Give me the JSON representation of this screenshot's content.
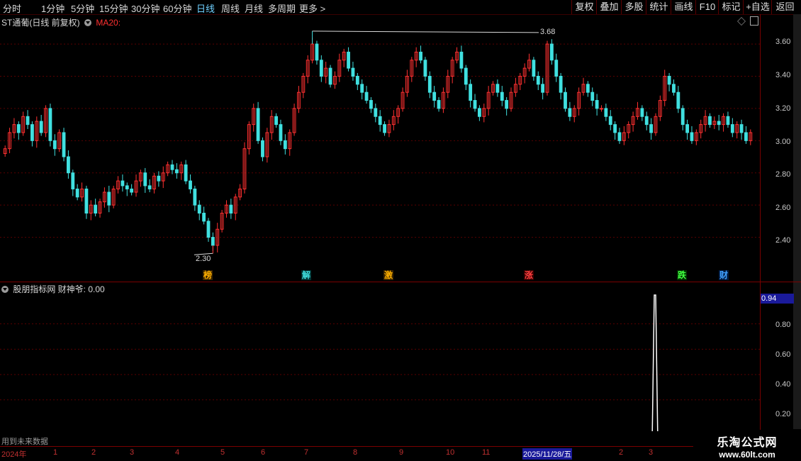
{
  "toolbar": {
    "periods": [
      "分时",
      "1分钟",
      "5分钟",
      "15分钟",
      "30分钟",
      "60分钟",
      "日线",
      "周线",
      "月线",
      "多周期",
      "更多 >"
    ],
    "active_period": "日线",
    "buttons": [
      "复权",
      "叠加",
      "多股",
      "统计",
      "画线",
      "F10",
      "标记",
      "+自选",
      "返回"
    ]
  },
  "main_panel": {
    "title": "ST通葡(日线 前复权)",
    "indicator": "MA20:",
    "indicator_color": "#ff3030",
    "y_labels": [
      "3.60",
      "3.40",
      "3.20",
      "3.00",
      "2.80",
      "2.60",
      "2.40"
    ],
    "high_label": "3.68",
    "low_label": "2.30",
    "tags": [
      {
        "text": "榜",
        "color": "#ffb000",
        "bg": "#3a2400"
      },
      {
        "text": "解",
        "color": "#40e0e0",
        "bg": "#003030"
      },
      {
        "text": "激",
        "color": "#ffb000",
        "bg": "#3a2400"
      },
      {
        "text": "涨",
        "color": "#ff4040",
        "bg": "#3a0000"
      },
      {
        "text": "跌",
        "color": "#40ff40",
        "bg": "#003000"
      },
      {
        "text": "财",
        "color": "#40a0ff",
        "bg": "#001a40"
      }
    ],
    "up_color": "#ff3030",
    "down_color": "#40e0e0"
  },
  "indicator_panel": {
    "title": "股朋指标网 财神爷: 0.00",
    "current_value": "0.94",
    "y_labels": [
      "0.80",
      "0.60",
      "0.40",
      "0.20"
    ],
    "footer_note": "用到未来数据"
  },
  "date_axis": {
    "labels": [
      "2024年",
      "1",
      "2",
      "3",
      "4",
      "5",
      "6",
      "7",
      "8",
      "9",
      "10",
      "11",
      "2025/11/28/五",
      "2",
      "3"
    ]
  },
  "watermark": {
    "title": "乐淘公式网",
    "url": "www.60lt.com"
  },
  "chart_data": {
    "type": "candlestick",
    "ylim": [
      2.2,
      3.75
    ],
    "y_ticks": [
      2.4,
      2.6,
      2.8,
      3.0,
      3.2,
      3.4,
      3.6
    ],
    "close_series": [
      2.95,
      3.05,
      3.1,
      3.05,
      3.15,
      3.1,
      3.0,
      3.12,
      3.05,
      3.2,
      3.0,
      2.95,
      3.05,
      2.9,
      2.8,
      2.7,
      2.65,
      2.7,
      2.55,
      2.6,
      2.55,
      2.62,
      2.68,
      2.6,
      2.7,
      2.75,
      2.72,
      2.7,
      2.68,
      2.75,
      2.8,
      2.72,
      2.7,
      2.78,
      2.75,
      2.8,
      2.85,
      2.82,
      2.8,
      2.85,
      2.75,
      2.7,
      2.6,
      2.55,
      2.5,
      2.4,
      2.35,
      2.45,
      2.55,
      2.6,
      2.55,
      2.65,
      2.7,
      2.95,
      3.1,
      3.2,
      3.0,
      2.9,
      3.05,
      3.15,
      3.1,
      3.0,
      2.95,
      3.05,
      3.2,
      3.3,
      3.4,
      3.5,
      3.6,
      3.5,
      3.4,
      3.45,
      3.35,
      3.4,
      3.5,
      3.55,
      3.45,
      3.4,
      3.35,
      3.3,
      3.25,
      3.2,
      3.15,
      3.1,
      3.05,
      3.1,
      3.15,
      3.2,
      3.3,
      3.4,
      3.5,
      3.55,
      3.5,
      3.4,
      3.3,
      3.25,
      3.2,
      3.3,
      3.4,
      3.5,
      3.55,
      3.45,
      3.35,
      3.25,
      3.2,
      3.15,
      3.2,
      3.3,
      3.35,
      3.3,
      3.25,
      3.2,
      3.3,
      3.35,
      3.4,
      3.45,
      3.5,
      3.4,
      3.35,
      3.3,
      3.6,
      3.5,
      3.4,
      3.3,
      3.2,
      3.15,
      3.2,
      3.3,
      3.35,
      3.3,
      3.25,
      3.2,
      3.2,
      3.15,
      3.1,
      3.05,
      3.0,
      3.05,
      3.1,
      3.15,
      3.2,
      3.15,
      3.1,
      3.05,
      3.15,
      3.25,
      3.4,
      3.35,
      3.3,
      3.2,
      3.1,
      3.05,
      3.0,
      3.05,
      3.1,
      3.15,
      3.1,
      3.12,
      3.1,
      3.15,
      3.1,
      3.05,
      3.1,
      3.05,
      3.0,
      3.05
    ],
    "high": 3.68,
    "low": 2.3,
    "indicator_series_peak": 0.94
  }
}
